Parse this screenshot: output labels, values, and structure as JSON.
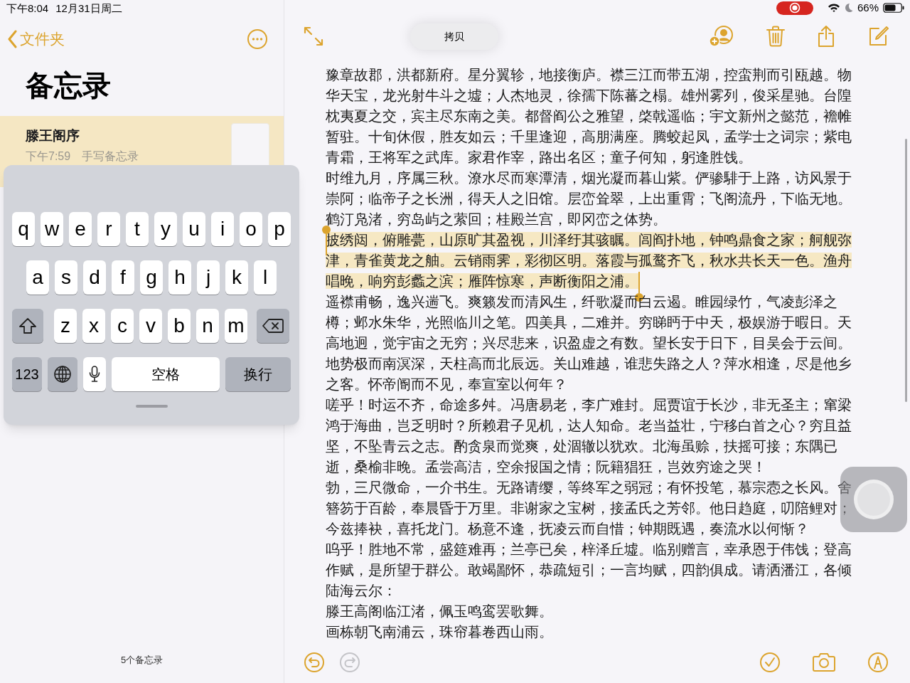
{
  "status_bar": {
    "time": "下午8:04",
    "date": "12月31日周二",
    "battery": "66%"
  },
  "sidebar": {
    "back": "文件夹",
    "title": "备忘录",
    "notes": [
      {
        "title": "滕王阁序",
        "time": "下午7:59",
        "preview": "手写备忘录",
        "selected": true
      }
    ],
    "footer": "5个备忘录"
  },
  "keyboard": {
    "key_lines": [
      [
        {
          "kind": "char",
          "label": "q"
        },
        {
          "kind": "char",
          "label": "w"
        },
        {
          "kind": "char",
          "label": "e"
        },
        {
          "kind": "char",
          "label": "r"
        },
        {
          "kind": "char",
          "label": "t"
        },
        {
          "kind": "char",
          "label": "y"
        },
        {
          "kind": "char",
          "label": "u"
        },
        {
          "kind": "char",
          "label": "i"
        },
        {
          "kind": "char",
          "label": "o"
        },
        {
          "kind": "char",
          "label": "p"
        }
      ],
      [
        {
          "kind": "char",
          "label": "a"
        },
        {
          "kind": "char",
          "label": "s"
        },
        {
          "kind": "char",
          "label": "d"
        },
        {
          "kind": "char",
          "label": "f"
        },
        {
          "kind": "char",
          "label": "g"
        },
        {
          "kind": "char",
          "label": "h"
        },
        {
          "kind": "char",
          "label": "j"
        },
        {
          "kind": "char",
          "label": "k"
        },
        {
          "kind": "char",
          "label": "l"
        }
      ],
      [
        {
          "kind": "shift"
        },
        {
          "kind": "char",
          "label": "z"
        },
        {
          "kind": "char",
          "label": "x"
        },
        {
          "kind": "char",
          "label": "c"
        },
        {
          "kind": "char",
          "label": "v"
        },
        {
          "kind": "char",
          "label": "b"
        },
        {
          "kind": "char",
          "label": "n"
        },
        {
          "kind": "char",
          "label": "m"
        },
        {
          "kind": "delete"
        }
      ],
      [
        {
          "kind": "numbers",
          "label": "123"
        },
        {
          "kind": "globe"
        },
        {
          "kind": "mic"
        },
        {
          "kind": "space",
          "label": "空格"
        },
        {
          "kind": "return",
          "label": "换行"
        }
      ]
    ]
  },
  "editor": {
    "copy_button": "拷贝",
    "paragraphs": [
      {
        "text": "豫章故郡，洪都新府。星分翼轸，地接衡庐。襟三江而带五湖，控蛮荆而引瓯越。物华天宝，龙光射牛斗之墟；人杰地灵，徐孺下陈蕃之榻。雄州雾列，俊采星驰。台隍枕夷夏之交，宾主尽东南之美。都督阎公之雅望，棨戟遥临；宇文新州之懿范，襜帷暂驻。十旬休假，胜友如云；千里逢迎，高朋满座。腾蛟起凤，孟学士之词宗；紫电青霜，王将军之武库。家君作宰，路出名区；童子何知，躬逢胜饯。",
        "selected": false
      },
      {
        "text": "时维九月，序属三秋。潦水尽而寒潭清，烟光凝而暮山紫。俨骖騑于上路，访风景于崇阿；临帝子之长洲，得天人之旧馆。层峦耸翠，上出重霄；飞阁流丹，下临无地。鹤汀凫渚，穷岛屿之萦回；桂殿兰宫，即冈峦之体势。",
        "selected": false
      },
      {
        "text": "披绣闼，俯雕甍，山原旷其盈视，川泽纡其骇瞩。闾阎扑地，钟鸣鼎食之家；舸舰弥津，青雀黄龙之舳。云销雨霁，彩彻区明。落霞与孤鹜齐飞，秋水共长天一色。渔舟唱晚，响穷彭蠡之滨；雁阵惊寒，声断衡阳之浦。",
        "selected": true
      },
      {
        "text": "遥襟甫畅，逸兴遄飞。爽籁发而清风生，纤歌凝而白云遏。睢园绿竹，气凌彭泽之樽；邺水朱华，光照临川之笔。四美具，二难并。穷睇眄于中天，极娱游于暇日。天高地迥，觉宇宙之无穷；兴尽悲来，识盈虚之有数。望长安于日下，目吴会于云间。地势极而南溟深，天柱高而北辰远。关山难越，谁悲失路之人？萍水相逢，尽是他乡之客。怀帝阍而不见，奉宣室以何年？",
        "selected": false
      },
      {
        "text": "嗟乎！时运不齐，命途多舛。冯唐易老，李广难封。屈贾谊于长沙，非无圣主；窜梁鸿于海曲，岂乏明时？所赖君子见机，达人知命。老当益壮，宁移白首之心？穷且益坚，不坠青云之志。酌贪泉而觉爽，处涸辙以犹欢。北海虽赊，扶摇可接；东隅已逝，桑榆非晚。孟尝高洁，空余报国之情；阮籍猖狂，岂效穷途之哭！",
        "selected": false
      },
      {
        "text": "勃，三尺微命，一介书生。无路请缨，等终军之弱冠；有怀投笔，慕宗悫之长风。舍簪笏于百龄，奉晨昏于万里。非谢家之宝树，接孟氏之芳邻。他日趋庭，叨陪鲤对；今兹捧袂，喜托龙门。杨意不逢，抚凌云而自惜；钟期既遇，奏流水以何惭？",
        "selected": false
      },
      {
        "text": "呜乎！胜地不常，盛筵难再；兰亭已矣，梓泽丘墟。临别赠言，幸承恩于伟饯；登高作赋，是所望于群公。敢竭鄙怀，恭疏短引；一言均赋，四韵俱成。请洒潘江，各倾陆海云尔：",
        "selected": false
      },
      {
        "text": "滕王高阁临江渚，佩玉鸣鸾罢歌舞。",
        "selected": false
      },
      {
        "text": "画栋朝飞南浦云，珠帘暮卷西山雨。",
        "selected": false
      }
    ],
    "history_tools": [
      {
        "kind": "undo",
        "disabled": false
      },
      {
        "kind": "redo",
        "disabled": true
      }
    ],
    "insert_tools": [
      {
        "kind": "checklist"
      },
      {
        "kind": "camera"
      },
      {
        "kind": "markup"
      }
    ]
  }
}
